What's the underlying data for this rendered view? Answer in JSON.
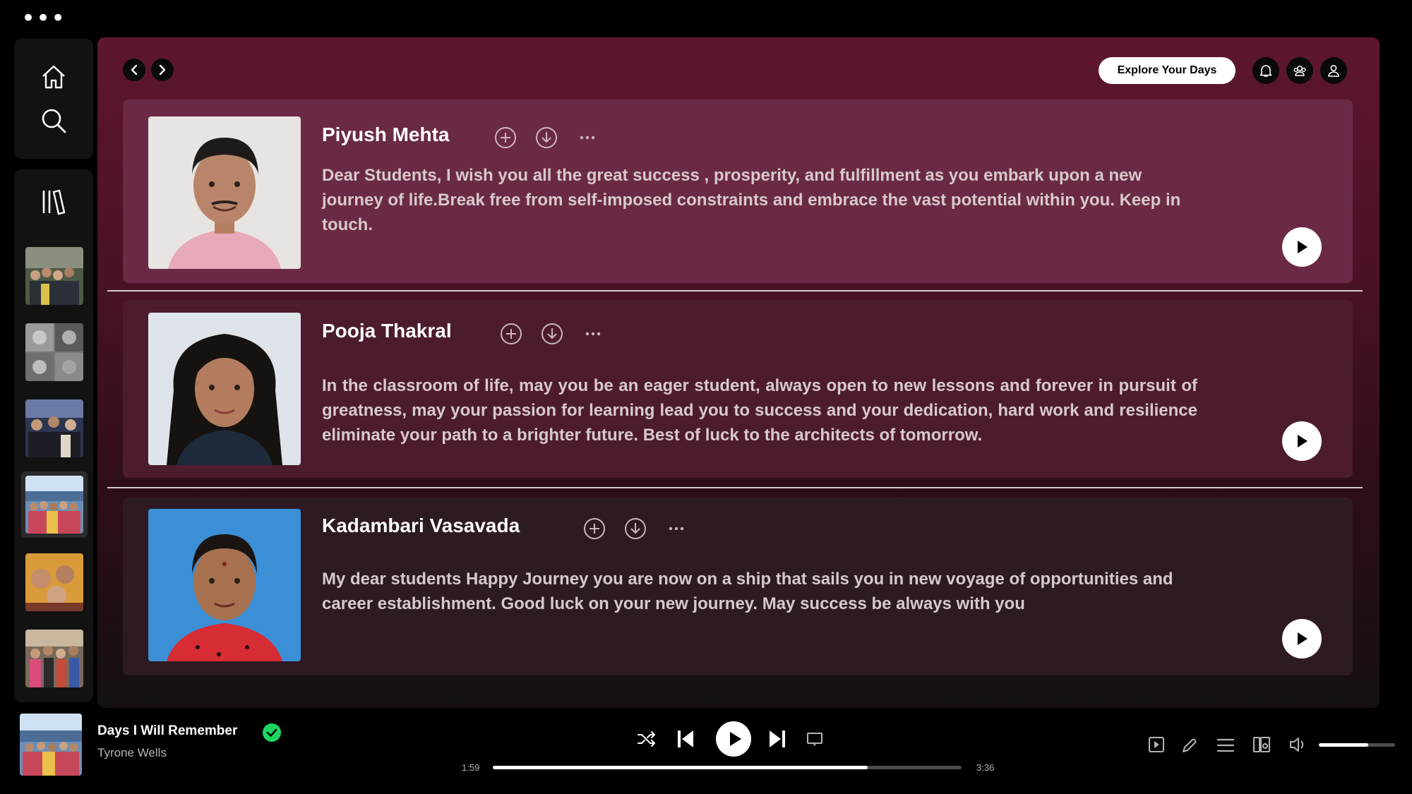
{
  "app": {
    "menu_dots": "•••"
  },
  "sidebar": {
    "nav": [
      {
        "name": "home",
        "icon": "home-icon"
      },
      {
        "name": "search",
        "icon": "search-icon"
      }
    ],
    "library_icon": "library-icon",
    "playlists": [
      {
        "name": "group-photo-1",
        "selected": false
      },
      {
        "name": "collage-photo",
        "selected": false
      },
      {
        "name": "group-photo-2",
        "selected": false
      },
      {
        "name": "group-photo-3",
        "selected": true
      },
      {
        "name": "selfie-photo",
        "selected": false
      },
      {
        "name": "group-photo-4",
        "selected": false
      }
    ]
  },
  "header": {
    "explore_label": "Explore Your Days",
    "icons": [
      "bell-icon",
      "friends-icon",
      "profile-icon"
    ]
  },
  "cards": [
    {
      "name": "Piyush Mehta",
      "message": "Dear Students, I wish you all the great success , prosperity, and fulfillment as you embark upon a new journey of life.Break free from self-imposed constraints and embrace the vast potential within you. Keep in touch."
    },
    {
      "name": "Pooja Thakral",
      "message": "In the classroom of life, may you be an eager student, always open to new lessons and forever in pursuit of greatness, may your passion for learning lead you to success and your dedication, hard work and resilience eliminate your path to a brighter future. Best of luck to the architects of tomorrow."
    },
    {
      "name": "Kadambari Vasavada",
      "message": "My dear students Happy Journey you are now on a ship that sails you in new voyage of opportunities and career establishment. Good luck on your new journey. May success be always with you"
    }
  ],
  "now_playing": {
    "title": "Days I Will Remember",
    "artist": "Tyrone Wells",
    "liked": true,
    "elapsed": "1:59",
    "duration": "3:36",
    "progress_fraction": 0.8,
    "volume_fraction": 0.65
  },
  "colors": {
    "accent_green": "#1ed760",
    "header_maroon": "#5e1630"
  }
}
